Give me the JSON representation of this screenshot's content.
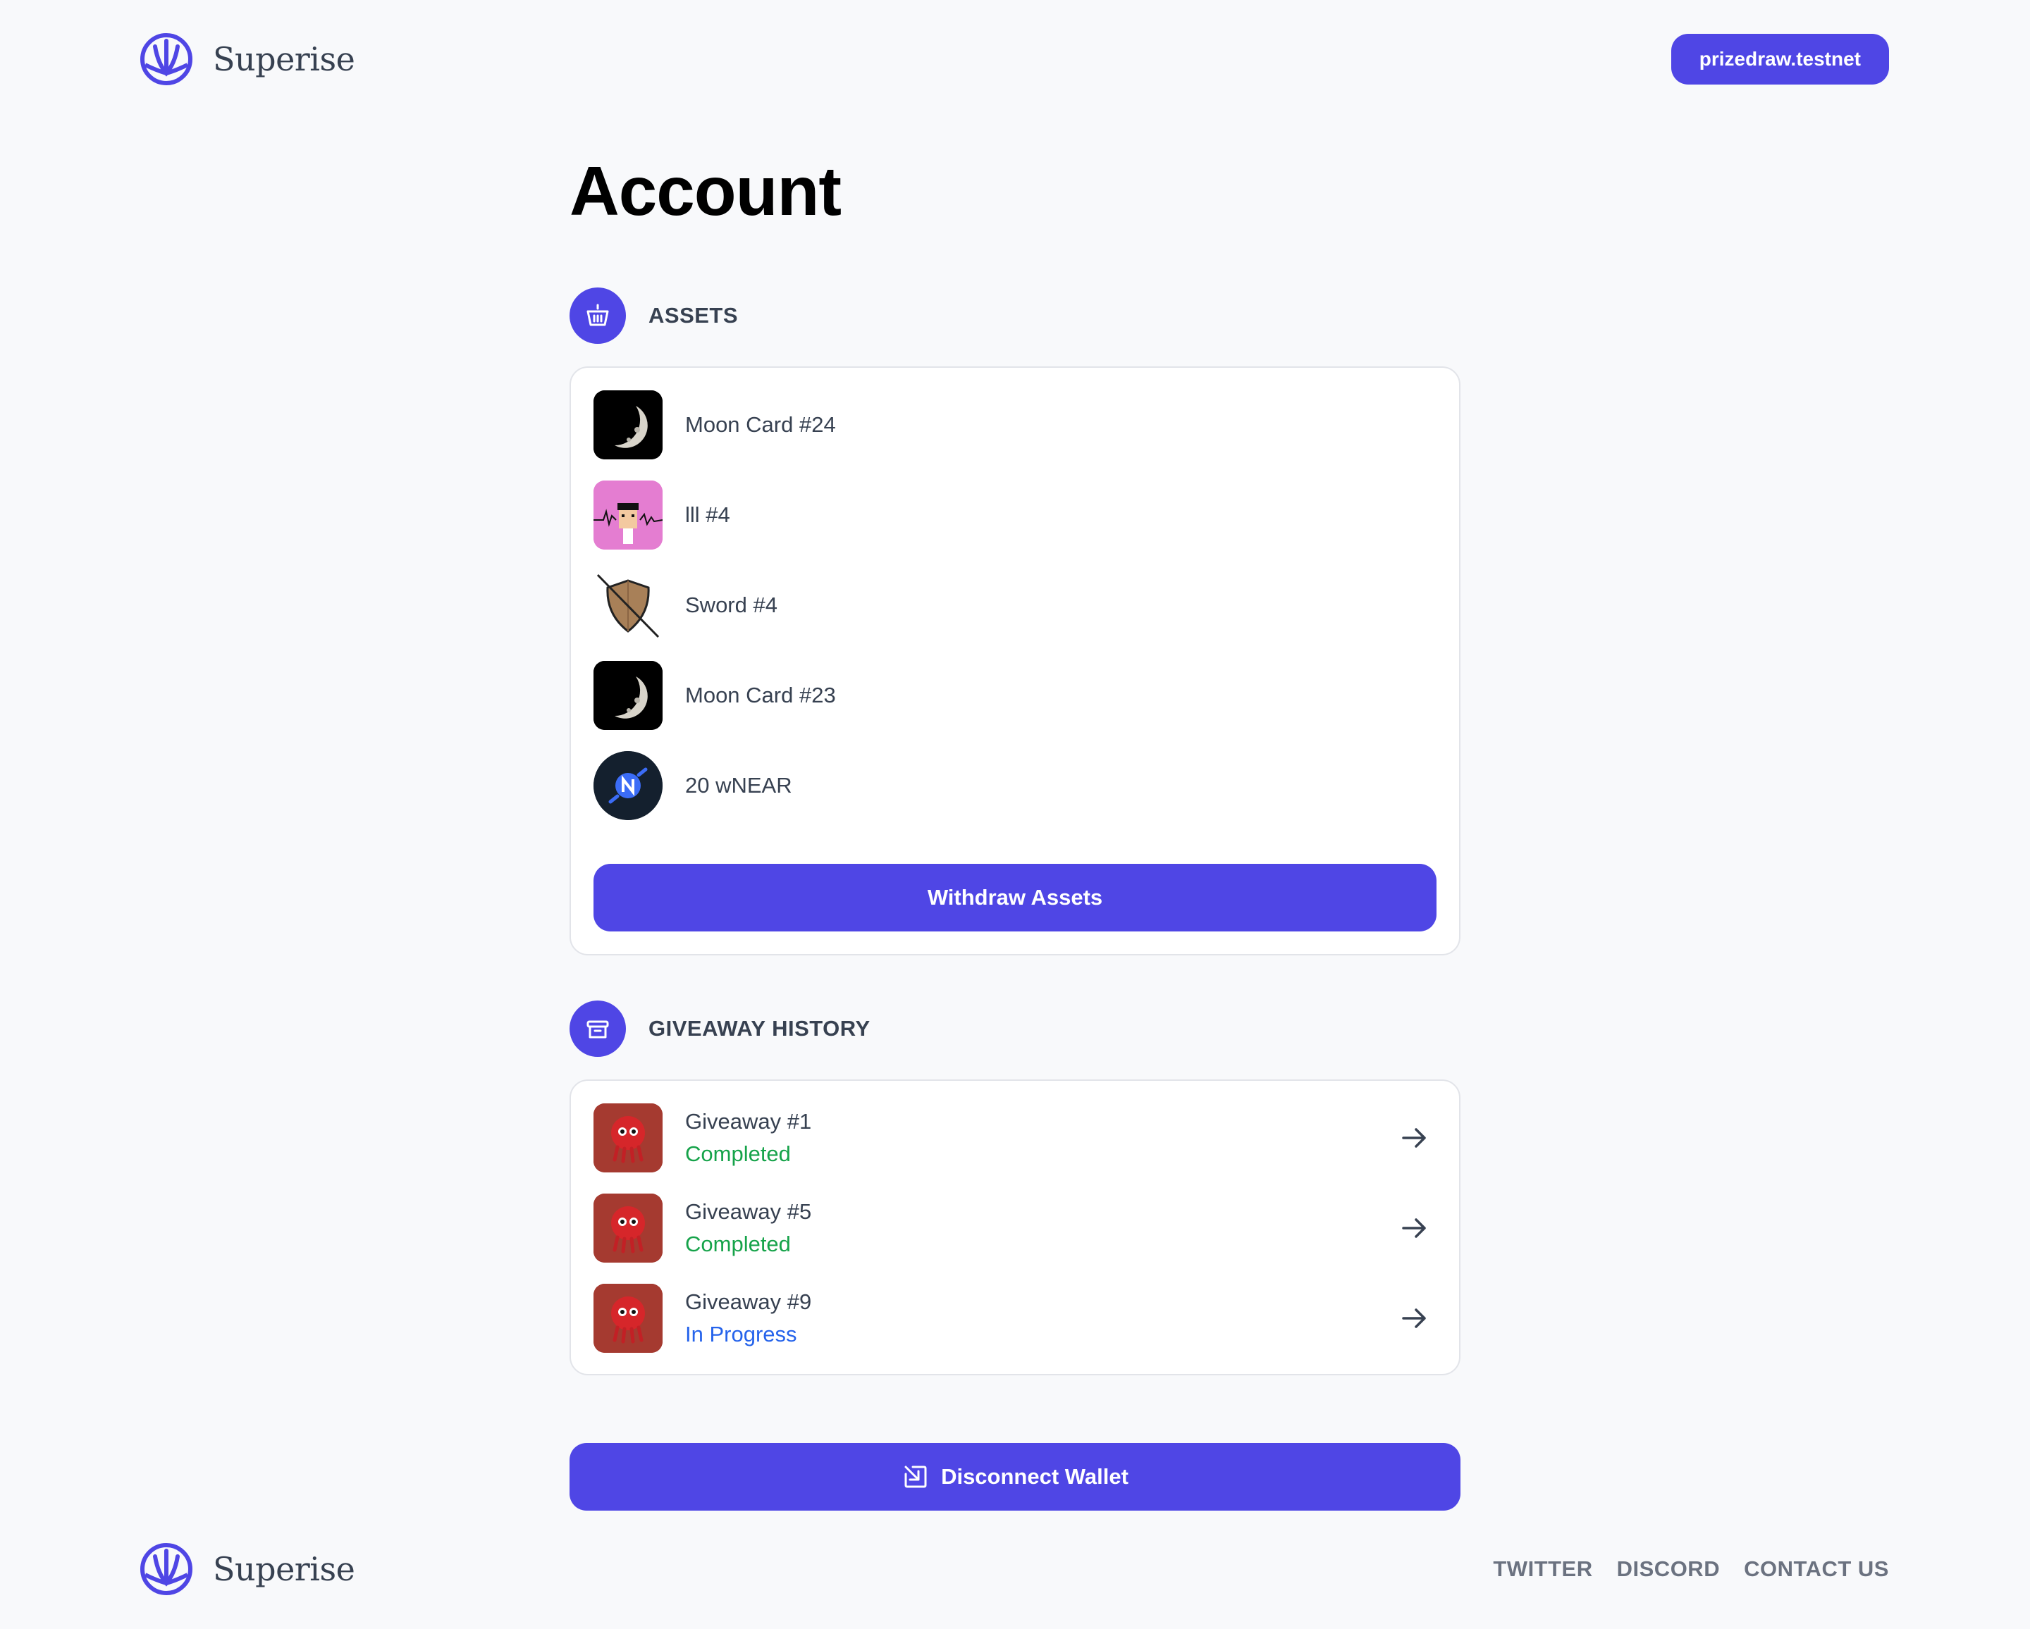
{
  "brand": {
    "name": "Superise",
    "accent": "#4f46e5"
  },
  "header": {
    "wallet_account": "prizedraw.testnet"
  },
  "page": {
    "title": "Account"
  },
  "assets": {
    "heading": "ASSETS",
    "icon": "basket-icon",
    "items": [
      {
        "label": "Moon Card #24",
        "thumb": "moon"
      },
      {
        "label": "lll #4",
        "thumb": "pixel-avatar"
      },
      {
        "label": "Sword #4",
        "thumb": "shield"
      },
      {
        "label": "Moon Card #23",
        "thumb": "moon"
      },
      {
        "label": "20 wNEAR",
        "thumb": "wnear-token"
      }
    ],
    "withdraw_label": "Withdraw Assets"
  },
  "history": {
    "heading": "GIVEAWAY HISTORY",
    "icon": "gift-box-icon",
    "items": [
      {
        "title": "Giveaway #1",
        "status": "Completed",
        "status_type": "completed"
      },
      {
        "title": "Giveaway #5",
        "status": "Completed",
        "status_type": "completed"
      },
      {
        "title": "Giveaway #9",
        "status": "In Progress",
        "status_type": "progress"
      }
    ]
  },
  "actions": {
    "disconnect_label": "Disconnect Wallet"
  },
  "footer": {
    "brand_name": "Superise",
    "links": [
      "TWITTER",
      "DISCORD",
      "CONTACT US"
    ]
  },
  "colors": {
    "primary": "#4f46e5",
    "completed": "#16a34a",
    "in_progress": "#2563eb"
  }
}
